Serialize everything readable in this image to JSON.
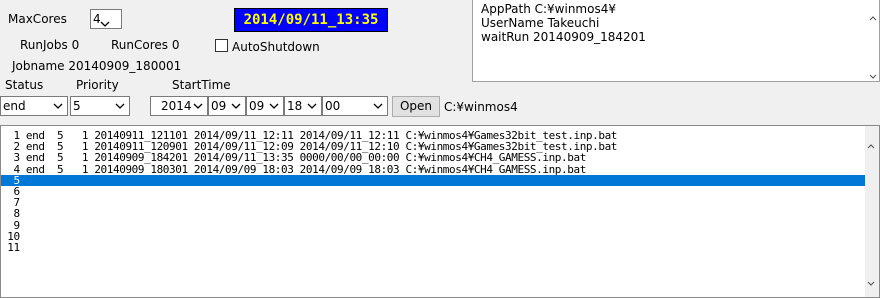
{
  "controls": {
    "maxcores_label": "MaxCores",
    "maxcores_value": "4",
    "clock": "2014/09/11_13:35",
    "runjobs": "RunJobs 0",
    "runcores": "RunCores 0",
    "autoshutdown_label": "AutoShutdown",
    "jobname": "Jobname 20140909_180001",
    "status_label": "Status",
    "priority_label": "Priority",
    "starttime_label": "StartTime",
    "status_value": "end",
    "priority_value": "5",
    "year": "2014",
    "month": "09",
    "day": "09",
    "hour": "18",
    "minute": "00",
    "open_label": "Open",
    "path": "C:¥winmos4"
  },
  "info": {
    "line1": "AppPath C:¥winmos4¥",
    "line2": "UserName Takeuchi",
    "line3": "waitRun 20140909_184201"
  },
  "jobs": [
    "  1 end  5   1 20140911_121101 2014/09/11_12:11 2014/09/11_12:11 C:¥winmos4¥Games32bit_test.inp.bat",
    "  2 end  5   1 20140911_120901 2014/09/11_12:09 2014/09/11_12:10 C:¥winmos4¥Games32bit_test.inp.bat",
    "  3 end  5   1 20140909_184201 2014/09/11_13:35 0000/00/00_00:00 C:¥winmos4¥CH4_GAMESS.inp.bat",
    "  4 end  5   1 20140909_180301 2014/09/09_18:03 2014/09/09_18:03 C:¥winmos4¥CH4_GAMESS.inp.bat",
    "  5",
    "  6",
    "  7",
    "  8",
    "  9",
    " 10",
    " 11"
  ],
  "selected_row": 4
}
